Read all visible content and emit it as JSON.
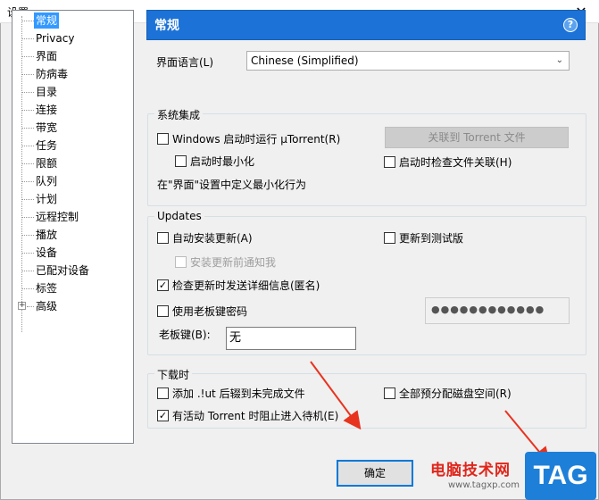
{
  "window": {
    "title": "设置",
    "close_glyph": "✕"
  },
  "tree": {
    "items": [
      {
        "label": "常规",
        "selected": true
      },
      {
        "label": "Privacy"
      },
      {
        "label": "界面"
      },
      {
        "label": "防病毒"
      },
      {
        "label": "目录"
      },
      {
        "label": "连接"
      },
      {
        "label": "带宽"
      },
      {
        "label": "任务"
      },
      {
        "label": "限额"
      },
      {
        "label": "队列"
      },
      {
        "label": "计划"
      },
      {
        "label": "远程控制"
      },
      {
        "label": "播放"
      },
      {
        "label": "设备"
      },
      {
        "label": "已配对设备"
      },
      {
        "label": "标签"
      },
      {
        "label": "高级",
        "expandable": true
      }
    ],
    "expand_glyph": "+"
  },
  "header": {
    "title": "常规",
    "help_glyph": "?"
  },
  "language": {
    "label": "界面语言(L)",
    "value": "Chinese (Simplified)",
    "arrow": "⌄"
  },
  "system": {
    "legend": "系统集成",
    "start_on_boot": "Windows 启动时运行 µTorrent(R)",
    "start_minimized": "启动时最小化",
    "associate_button": "关联到 Torrent 文件",
    "check_assoc": "启动时检查文件关联(H)",
    "minimize_note": "在\"界面\"设置中定义最小化行为"
  },
  "updates": {
    "legend": "Updates",
    "auto_install": "自动安装更新(A)",
    "beta": "更新到测试版",
    "notify_before": "安装更新前通知我",
    "send_info": "检查更新时发送详细信息(匿名)",
    "send_info_checked": true,
    "boss_key_pwd": "使用老板键密码",
    "password_mask": "●●●●●●●●●●●●",
    "boss_key_label": "老板键(B):",
    "boss_key_value": "无"
  },
  "download": {
    "legend": "下载时",
    "append_ut": "添加 .!ut 后辍到未完成文件",
    "prealloc": "全部预分配磁盘空间(R)",
    "prevent_standby": "有活动 Torrent 时阻止进入待机(E)",
    "prevent_standby_checked": true
  },
  "buttons": {
    "ok": "确定",
    "check_glyph": "✓"
  },
  "watermark": {
    "text": "电脑技术网",
    "url": "www.tagxp.com",
    "tag": "TAG"
  },
  "colors": {
    "header_bg": "#1c72d6",
    "selection": "#3399ff",
    "arrow": "#e8331f"
  }
}
